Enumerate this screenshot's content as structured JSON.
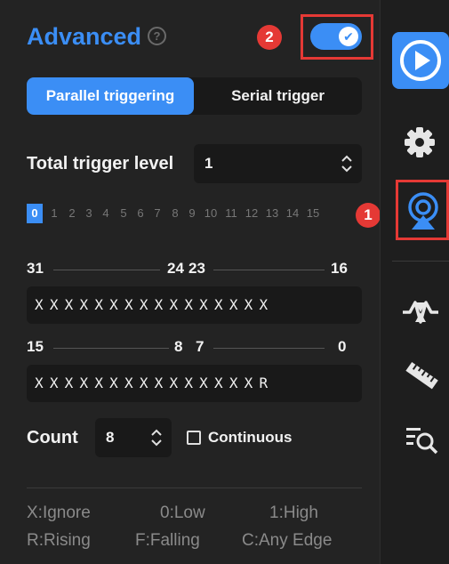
{
  "panel": {
    "title": "Advanced",
    "help_icon": "question-circle-icon",
    "toggle_on": true,
    "tabs": [
      {
        "label": "Parallel triggering",
        "active": true
      },
      {
        "label": "Serial trigger",
        "active": false
      }
    ],
    "total_trigger_level": {
      "label": "Total trigger level",
      "value": "1"
    },
    "levels": [
      "0",
      "1",
      "2",
      "3",
      "4",
      "5",
      "6",
      "7",
      "8",
      "9",
      "10",
      "11",
      "12",
      "13",
      "14",
      "15"
    ],
    "active_level": "0",
    "upper_word": {
      "labels": [
        "31",
        "24",
        "23",
        "16"
      ],
      "pattern": "XXXXXXXXXXXXXXXX"
    },
    "lower_word": {
      "labels": [
        "15",
        "8",
        "7",
        "0"
      ],
      "pattern": "XXXXXXXXXXXXXXXR"
    },
    "count": {
      "label": "Count",
      "value": "8"
    },
    "continuous": {
      "label": "Continuous",
      "checked": false
    },
    "legend": [
      [
        "X:Ignore",
        "0:Low",
        "1:High"
      ],
      [
        "R:Rising",
        "F:Falling",
        "C:Any Edge"
      ]
    ]
  },
  "markers": {
    "m1": "1",
    "m2": "2"
  },
  "rail": {
    "items": [
      "play-icon",
      "gear-icon",
      "trigger-icon",
      "waveform-icon",
      "ruler-icon",
      "search-list-icon"
    ],
    "active": "play-icon"
  },
  "colors": {
    "accent": "#3b8ef5",
    "marker": "#e53935",
    "background": "#232323"
  }
}
